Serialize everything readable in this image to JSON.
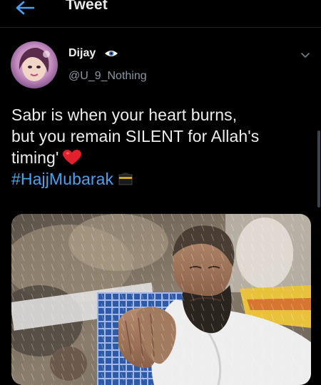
{
  "header": {
    "title": "Tweet",
    "back_icon": "arrow-left-icon"
  },
  "tweet": {
    "author_name": "Dijay",
    "name_emoji": "eye-emoji-icon",
    "handle": "@U_9_Nothing",
    "text_lines": [
      "Sabr is when your heart burns,",
      "but you remain SILENT for Allah's",
      "timing'"
    ],
    "hashtag": "#HajjMubarak",
    "emojis": {
      "heart": "red-heart-icon",
      "kaaba": "kaaba-icon"
    }
  },
  "colors": {
    "background": "#000000",
    "text": "#ededed",
    "secondary": "#8b98a5",
    "link": "#4aa3f0",
    "accent_heart": "#e0202a"
  }
}
